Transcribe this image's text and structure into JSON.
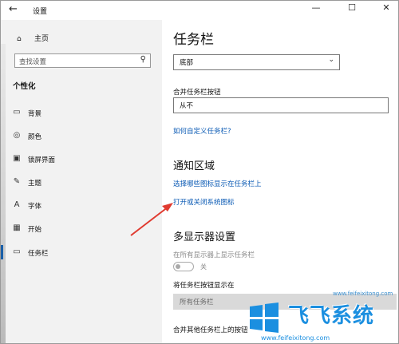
{
  "window": {
    "title": "设置",
    "back_icon": "←",
    "minimize": "—",
    "maximize": "☐",
    "close": "✕"
  },
  "sidebar": {
    "home_label": "主页",
    "search_placeholder": "查找设置",
    "section_label": "个性化",
    "items": [
      {
        "icon": "▭",
        "label": "背景"
      },
      {
        "icon": "◎",
        "label": "颜色"
      },
      {
        "icon": "▣",
        "label": "锁屏界面"
      },
      {
        "icon": "✎",
        "label": "主题"
      },
      {
        "icon": "A",
        "label": "字体"
      },
      {
        "icon": "▦",
        "label": "开始"
      },
      {
        "icon": "▭",
        "label": "任务栏"
      }
    ]
  },
  "main": {
    "title": "任务栏",
    "position_dropdown_value": "底部",
    "combine_label": "合并任务栏按钮",
    "combine_value": "从不",
    "customize_link": "如何自定义任务栏?",
    "notification_heading": "通知区域",
    "select_icons_link": "选择哪些图标显示在任务栏上",
    "system_icons_link": "打开或关闭系统图标",
    "multi_display_heading": "多显示器设置",
    "show_all_displays_label": "在所有显示器上显示任务栏",
    "toggle_state": "关",
    "show_buttons_on_label": "将任务栏按钮显示在",
    "show_buttons_on_value": "所有任务栏",
    "combine_other_label": "合并其他任务栏上的按钮"
  },
  "watermark": {
    "brand": "飞飞系统",
    "url": "www.feifeixitong.com",
    "url_bottom": "www.feifeixitong.com"
  },
  "colors": {
    "link": "#0a5ab4",
    "accent": "#1a5fa8",
    "arrow": "#e03a2f",
    "watermark": "#1b8fe0"
  }
}
